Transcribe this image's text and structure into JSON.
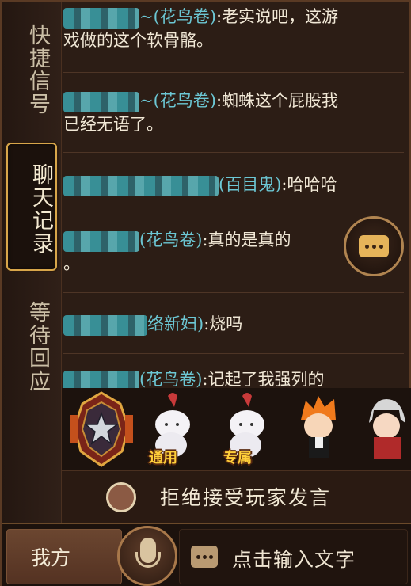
{
  "tabs": [
    {
      "label": "快捷信号",
      "active": false
    },
    {
      "label": "聊天记录",
      "active": true
    },
    {
      "label": "等待回应",
      "active": false
    }
  ],
  "messages": [
    {
      "sender": "~(花鸟卷)",
      "text_line1": ":老实说吧，这游",
      "text_line2": "戏做的这个软骨骼。"
    },
    {
      "sender": "~(花鸟卷)",
      "text_line1": ":蜘蛛这个屁股我",
      "text_line2": "已经无语了。"
    },
    {
      "sender": "(百目鬼)",
      "text_line1": ":哈哈哈",
      "text_line2": ""
    },
    {
      "sender": "(花鸟卷)",
      "text_line1": ":真的是真的",
      "text_line2": "。"
    },
    {
      "sender": "络新妇)",
      "text_line1": ":烧吗",
      "text_line2": ""
    },
    {
      "sender": "(花鸟卷)",
      "text_line1": ":记起了我强列的",
      "text_line2": ""
    }
  ],
  "stickers": [
    {
      "name": "badge-sticker",
      "label": ""
    },
    {
      "name": "common-sticker",
      "label": "通用"
    },
    {
      "name": "exclusive-sticker",
      "label": "专属"
    },
    {
      "name": "orange-hair-sticker",
      "label": ""
    },
    {
      "name": "white-hair-sticker",
      "label": ""
    }
  ],
  "reject": {
    "label": "拒绝接受玩家发言"
  },
  "bottom": {
    "mine_label": "我方",
    "input_placeholder": "点击输入文字"
  },
  "colors": {
    "accent": "#d8a64a",
    "name": "#6cc7d4",
    "text": "#f1e8d6"
  }
}
